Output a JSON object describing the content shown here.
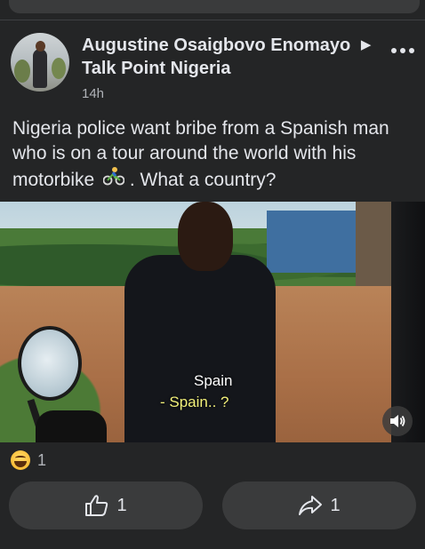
{
  "post": {
    "author": "Augustine Osaigbovo Enomayo",
    "group": "Talk Point Nigeria",
    "time": "14h",
    "text": "Nigeria police want bribe from a Spanish man who is on a tour  around the world with his motorbike",
    "text_tail": ".  What a country?",
    "video": {
      "subtitle_line1": "Spain",
      "subtitle_line2": "- Spain.. ?"
    },
    "reactions": {
      "count": "1"
    },
    "actions": {
      "like_count": "1",
      "share_count": "1"
    }
  },
  "icons": {
    "more": "more-options-icon",
    "sound": "speaker-icon",
    "like": "thumbs-up-icon",
    "share": "share-arrow-icon",
    "reaction": "laugh-emoji-icon",
    "bike": "bicyclist-emoji"
  }
}
